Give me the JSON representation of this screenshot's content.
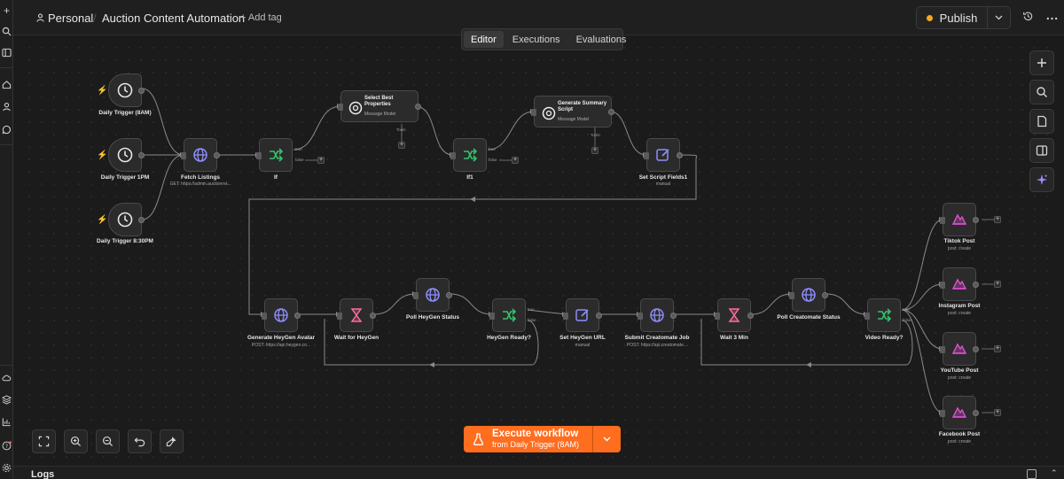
{
  "header": {
    "workspace": "Personal",
    "separator": "/",
    "workflow_title": "Auction Content Automation",
    "add_tag": "+ Add tag",
    "publish": "Publish"
  },
  "tabs": [
    "Editor",
    "Executions",
    "Evaluations"
  ],
  "active_tab": "Editor",
  "nodes": {
    "trigger1": {
      "label": "Daily Trigger (8AM)"
    },
    "trigger2": {
      "label": "Daily Trigger 1PM"
    },
    "trigger3": {
      "label": "Daily Trigger 8:30PM"
    },
    "fetch": {
      "label": "Fetch Listings",
      "sub": "GET: https://admin.auctionret..."
    },
    "if": {
      "label": "If"
    },
    "select": {
      "title": "Select Best Properties",
      "sub": "Message Model",
      "port": "Tools"
    },
    "if1": {
      "label": "If1"
    },
    "summary": {
      "title": "Generate Summary Script",
      "sub": "Message Model",
      "port": "Tools"
    },
    "setscript": {
      "label": "Set Script Fields1",
      "sub": "manual"
    },
    "heygen": {
      "label": "Generate HeyGen Avatar",
      "sub": "POST: https://api.heygen.co..."
    },
    "waitheygen": {
      "label": "Wait for HeyGen"
    },
    "pollheygen": {
      "label": "Poll HeyGen Status"
    },
    "heygenready": {
      "label": "HeyGen Ready?"
    },
    "seturl": {
      "label": "Set HeyGen URL",
      "sub": "manual"
    },
    "creatomate": {
      "label": "Submit Creatomate Job",
      "sub": "POST: https://api.creatomate..."
    },
    "wait3": {
      "label": "Wait 3 Min"
    },
    "pollcreatomate": {
      "label": "Poll Creatomate Status"
    },
    "videoready": {
      "label": "Video Ready?"
    },
    "tiktok": {
      "label": "Tiktok Post",
      "sub": "post: create"
    },
    "instagram": {
      "label": "Instagram Post",
      "sub": "post: create"
    },
    "youtube": {
      "label": "YouTube Post",
      "sub": "post: create"
    },
    "facebook": {
      "label": "Facebook Post",
      "sub": "post: create"
    }
  },
  "branch_labels": {
    "true": "true",
    "false": "false"
  },
  "execute": {
    "title": "Execute workflow",
    "subtitle": "from Daily Trigger (8AM)"
  },
  "logs": {
    "label": "Logs"
  },
  "colors": {
    "accent": "#ff6d1f",
    "if_icon": "#35c26a",
    "http_icon": "#8e8efc",
    "wait_icon": "#ff6aa0",
    "set_icon": "#8e8efc",
    "social_icon": "#e04ecf"
  }
}
